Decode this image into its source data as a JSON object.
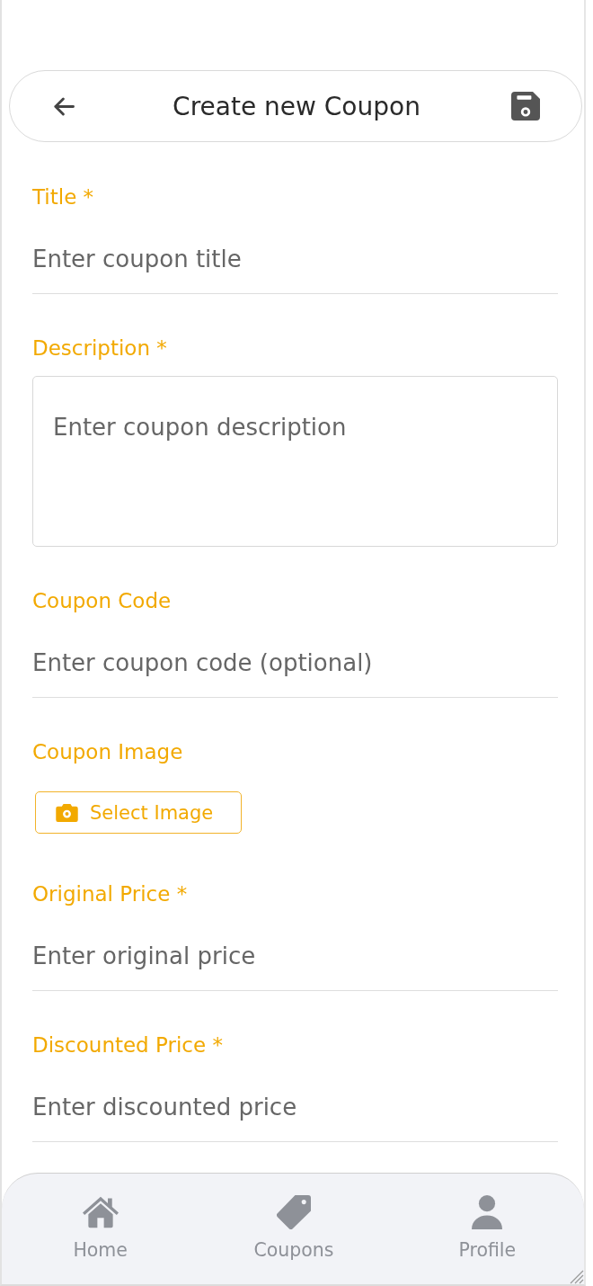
{
  "header": {
    "title": "Create new Coupon"
  },
  "fields": [
    {
      "kind": "input",
      "label": "Title *",
      "placeholder": "Enter coupon title"
    },
    {
      "kind": "textarea",
      "label": "Description *",
      "placeholder": "Enter coupon description"
    },
    {
      "kind": "input",
      "label": "Coupon Code",
      "placeholder": "Enter coupon code (optional)"
    },
    {
      "kind": "image",
      "label": "Coupon Image",
      "button": "Select Image"
    },
    {
      "kind": "input",
      "label": "Original Price *",
      "placeholder": "Enter original price"
    },
    {
      "kind": "input",
      "label": "Discounted Price *",
      "placeholder": "Enter discounted price"
    }
  ],
  "nav": [
    {
      "label": "Home",
      "selected": false
    },
    {
      "label": "Coupons",
      "selected": false
    },
    {
      "label": "Profile",
      "selected": false
    }
  ]
}
